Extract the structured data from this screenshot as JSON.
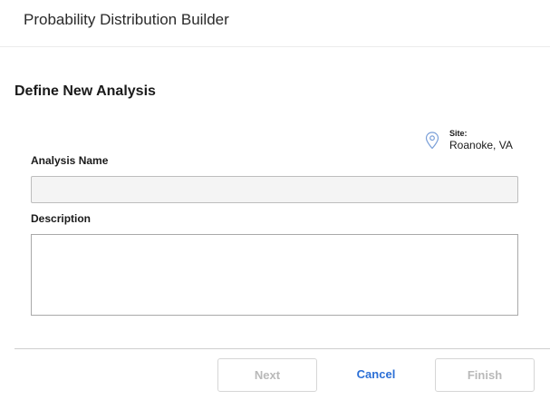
{
  "header": {
    "title": "Probability Distribution Builder"
  },
  "section": {
    "title": "Define New Analysis"
  },
  "site": {
    "label": "Site:",
    "value": "Roanoke, VA",
    "icon": "map-pin-icon"
  },
  "form": {
    "analysis_name": {
      "label": "Analysis Name",
      "value": "",
      "placeholder": ""
    },
    "description": {
      "label": "Description",
      "value": "",
      "placeholder": ""
    }
  },
  "footer": {
    "next_label": "Next",
    "cancel_label": "Cancel",
    "finish_label": "Finish"
  },
  "colors": {
    "accent": "#2b6fd6",
    "disabled_text": "#b9b9b9",
    "pin_icon": "#7a9fd8"
  }
}
